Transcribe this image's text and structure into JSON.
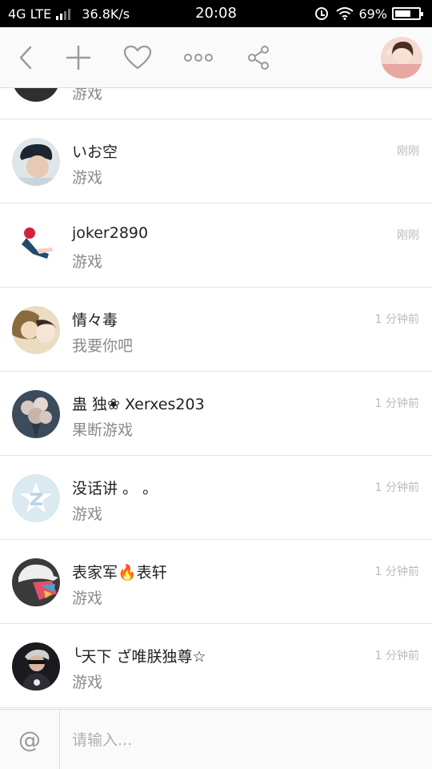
{
  "status_bar": {
    "network": "4G LTE",
    "speed": "36.8K/s",
    "time": "20:08",
    "battery": "69%",
    "battery_level": 0.69
  },
  "toolbar": {
    "icons": [
      "back-icon",
      "add-icon",
      "heart-icon",
      "more-icon",
      "share-icon"
    ]
  },
  "messages": [
    {
      "name": "",
      "text": "游戏",
      "time": ""
    },
    {
      "name": "いお空",
      "text": "游戏",
      "time": "刚刚"
    },
    {
      "name": "joker2890",
      "text": "游戏",
      "time": "刚刚"
    },
    {
      "name": "情々毒",
      "text": "我要你吧",
      "time": "1 分钟前"
    },
    {
      "name": "蛊 独❀ Xerxes203",
      "text": "果断游戏",
      "time": "1 分钟前"
    },
    {
      "name": "没话讲 。 。",
      "text": "游戏",
      "time": "1 分钟前"
    },
    {
      "name": "表家军🔥表轩",
      "text": "游戏",
      "time": "1 分钟前"
    },
    {
      "name": "╰天下 ざ唯朕独尊☆",
      "text": "游戏",
      "time": "1 分钟前"
    }
  ],
  "input": {
    "at_symbol": "@",
    "placeholder": "请输入..."
  },
  "colors": {
    "background": "#ffffff",
    "toolbar": "#fafafa",
    "icon": "#9a9a9a",
    "timestamp": "#bbbbbb",
    "divider": "#e2e2e2"
  }
}
